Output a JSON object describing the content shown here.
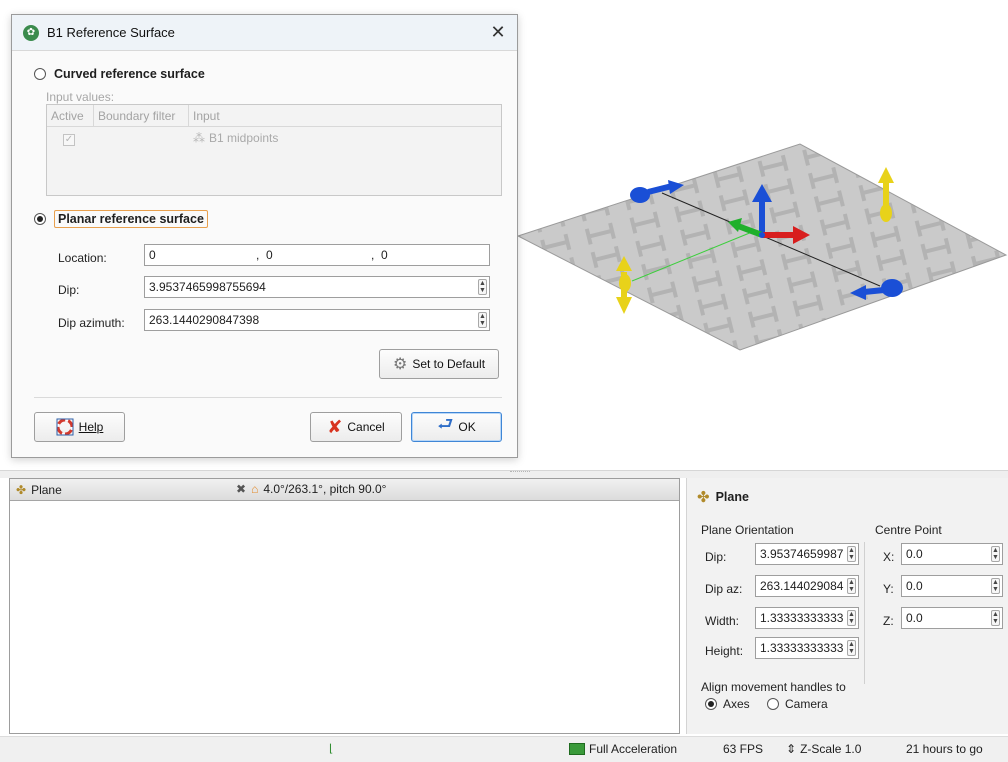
{
  "dialog": {
    "title": "B1 Reference Surface",
    "close_glyph": "✕",
    "curved_option": {
      "label": "Curved reference surface",
      "selected": false
    },
    "input_values_label": "Input values:",
    "grid": {
      "columns": [
        "Active",
        "Boundary filter",
        "Input"
      ],
      "rows": [
        {
          "active": true,
          "boundary_filter": "",
          "input": "B1 midpoints"
        }
      ]
    },
    "planar_option": {
      "label": "Planar reference surface",
      "selected": true
    },
    "location": {
      "label": "Location:",
      "x": "0",
      "y": "0",
      "z": "0",
      "sep": ","
    },
    "dip": {
      "label": "Dip:",
      "value": "3.9537465998755694"
    },
    "dip_azimuth": {
      "label": "Dip azimuth:",
      "value": "263.1440290847398"
    },
    "set_default_label": "Set to Default",
    "help_label": "Help",
    "cancel_label": "Cancel",
    "ok_label": "OK"
  },
  "left_panel": {
    "title": "Plane",
    "orientation": "4.0°/263.1°, pitch 90.0°"
  },
  "properties": {
    "title": "Plane",
    "orientation_group": "Plane Orientation",
    "centre_group": "Centre Point",
    "dip_label": "Dip:",
    "dip_value": "3.95374659987",
    "dipaz_label": "Dip az:",
    "dipaz_value": "263.144029084",
    "width_label": "Width:",
    "width_value": "1.33333333333",
    "height_label": "Height:",
    "height_value": "1.33333333333",
    "x_label": "X:",
    "x_value": "0.0",
    "y_label": "Y:",
    "y_value": "0.0",
    "z_label": "Z:",
    "z_value": "0.0",
    "align_label": "Align movement handles to",
    "align_options": [
      {
        "label": "Axes",
        "selected": true
      },
      {
        "label": "Camera",
        "selected": false
      }
    ]
  },
  "statusbar": {
    "acceleration": "Full Acceleration",
    "fps": "63 FPS",
    "zscale": "Z-Scale 1.0",
    "time_left": "21 hours to go"
  },
  "colors": {
    "accent_focus": "#e8a04e",
    "ok_border": "#3f86d6",
    "handle_blue": "#1a4fd6",
    "handle_yellow": "#e8d21a",
    "axis_red": "#d81e1e",
    "axis_green": "#1fb02b",
    "plane_gray": "#c8c8c8"
  }
}
